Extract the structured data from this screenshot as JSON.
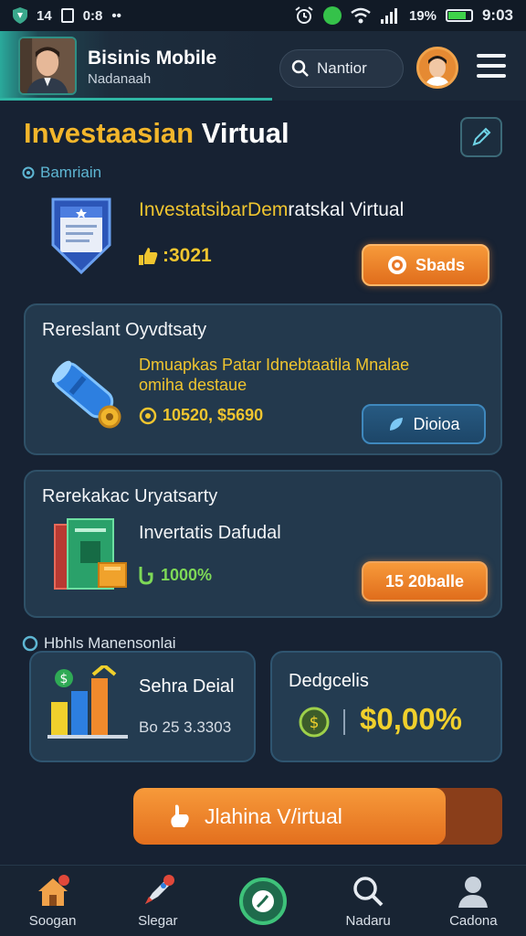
{
  "status_bar": {
    "left_items": [
      "14",
      "0:8"
    ],
    "dots": "••",
    "battery_percent": "19%",
    "time": "9:03",
    "battery_level": 0.8
  },
  "header": {
    "title": "Bisinis Mobile",
    "subtitle": "Nadanaah",
    "search_label": "Nantior",
    "accent_color": "#2fb6a4"
  },
  "main": {
    "title_part1": "Investaasian",
    "title_part2": " Virtual",
    "section1_label": "Bamriain",
    "item1": {
      "title_highlight": "InvestatsibarDem",
      "title_rest": "ratskal Virtual",
      "value": ":3021",
      "button_label": "Sbads"
    },
    "card1": {
      "title": "Rereslant Oyvdtsaty",
      "desc_line1": "Dmuapkas Patar Idnebtaatila Mnalae",
      "desc_line2": "omiha destaue",
      "value": "10520, $5690",
      "button_label": "Dioioa"
    },
    "card2": {
      "title": "Rerekakac Uryatsarty",
      "item_title": "Invertatis Dafudal",
      "value": "1000%",
      "button_label": "15 20balle"
    },
    "section2_label": "Hbhls Manensonlai",
    "mini1": {
      "title": "Sehra Deial",
      "value": "Bo 25 3.3303"
    },
    "mini2": {
      "title": "Dedgcelis",
      "value": "$0,00%"
    },
    "cta_label": "Jlahina V/irtual"
  },
  "nav": {
    "items": [
      {
        "label": "Soogan",
        "icon": "home-icon"
      },
      {
        "label": "Slegar",
        "icon": "rocket-icon"
      },
      {
        "label": "",
        "icon": "clock-icon"
      },
      {
        "label": "Nadaru",
        "icon": "search-icon"
      },
      {
        "label": "Cadona",
        "icon": "user-icon"
      }
    ]
  },
  "colors": {
    "gold": "#f0c52f",
    "orange": "#f0872c",
    "teal": "#5eb6d3",
    "background": "#172233"
  }
}
